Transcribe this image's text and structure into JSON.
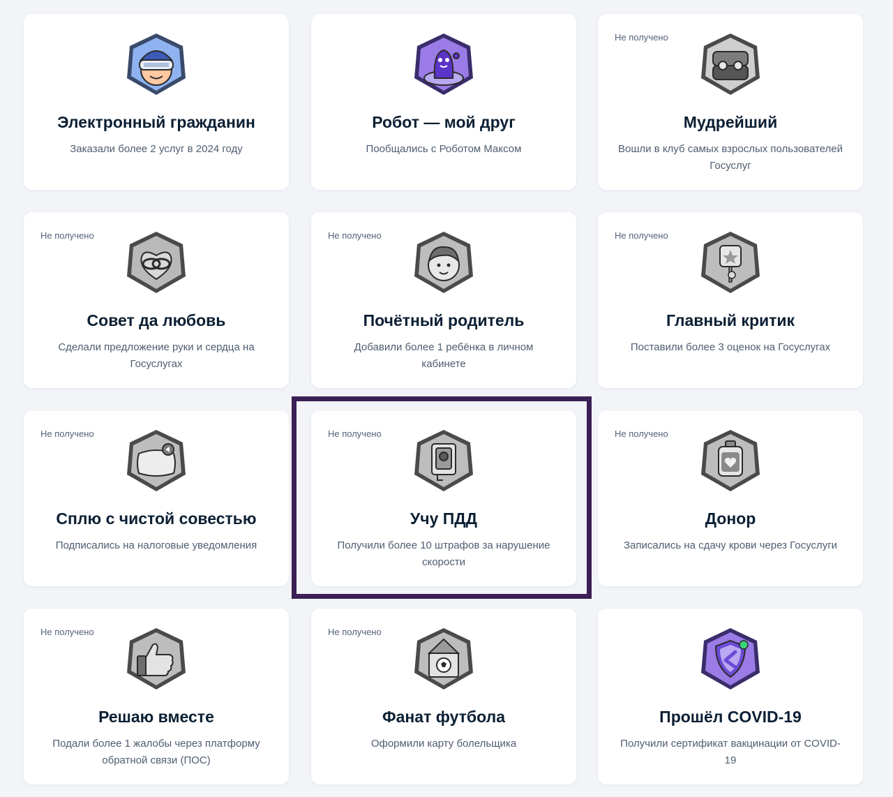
{
  "achievements": [
    {
      "title": "Электронный гражданин",
      "description": "Заказали более 2 услуг в 2024 году",
      "status": "",
      "badge_icon": "vr-headset-person-icon"
    },
    {
      "title": "Робот — мой друг",
      "description": "Пообщались с Роботом Максом",
      "status": "",
      "badge_icon": "robot-max-icon"
    },
    {
      "title": "Мудрейший",
      "description": "Вошли в клуб самых взрослых пользователей Госуслуг",
      "status": "Не получено",
      "badge_icon": "glasses-case-icon"
    },
    {
      "title": "Совет да любовь",
      "description": "Сделали предложение руки и сердца на Госуслугах",
      "status": "Не получено",
      "badge_icon": "wedding-rings-icon"
    },
    {
      "title": "Почётный родитель",
      "description": "Добавили более 1 ребёнка в личном кабинете",
      "status": "Не получено",
      "badge_icon": "child-face-icon"
    },
    {
      "title": "Главный критик",
      "description": "Поставили более 3 оценок на Госуслугах",
      "status": "Не получено",
      "badge_icon": "rating-sign-icon"
    },
    {
      "title": "Сплю с чистой совестью",
      "description": "Подписались на налоговые уведомления",
      "status": "Не получено",
      "badge_icon": "pillow-icon"
    },
    {
      "title": "Учу ПДД",
      "description": "Получили более 10 штрафов за нарушение скорости",
      "status": "Не получено",
      "badge_icon": "speed-camera-icon"
    },
    {
      "title": "Донор",
      "description": "Записались на сдачу крови через Госуслуги",
      "status": "Не получено",
      "badge_icon": "blood-bag-icon"
    },
    {
      "title": "Решаю вместе",
      "description": "Подали более 1 жалобы через платформу обратной связи (ПОС)",
      "status": "Не получено",
      "badge_icon": "thumbs-up-icon"
    },
    {
      "title": "Фанат футбола",
      "description": "Оформили карту болельщика",
      "status": "Не получено",
      "badge_icon": "football-card-icon"
    },
    {
      "title": "Прошёл COVID-19",
      "description": "Получили сертификат вакцинации от COVID-19",
      "status": "",
      "badge_icon": "vaccine-shield-icon"
    }
  ],
  "colors": {
    "page_bg": "#f2f4f8",
    "card_bg": "#ffffff",
    "highlight_border": "#3b1f55",
    "earned_blue": "#8fb3f0",
    "earned_purple": "#9b7be6",
    "locked_gray": "#b9b9b9"
  }
}
